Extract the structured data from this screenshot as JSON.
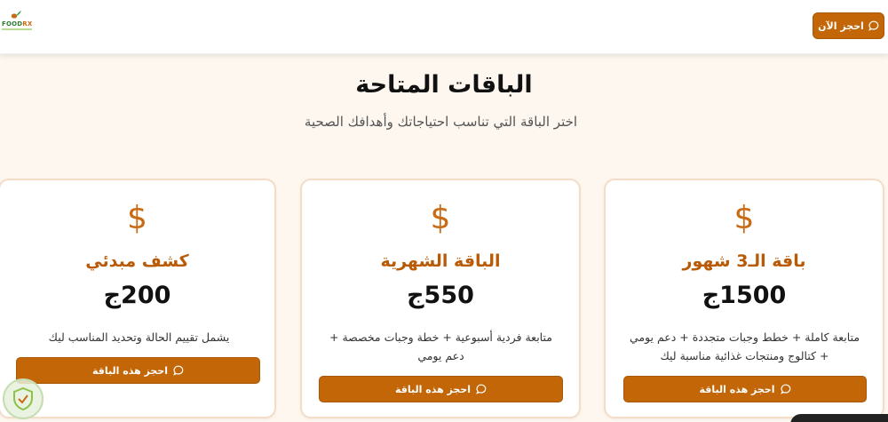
{
  "header": {
    "logo_text_food": "FOOD",
    "logo_text_rx": "RX",
    "book_now_label": "احجز الآن",
    "book_now_icon": "chat-bubble-icon"
  },
  "section": {
    "title": "الباقات المتاحة",
    "subtitle": "اختر الباقة التي تناسب احتياجاتك وأهدافك الصحية"
  },
  "plans": [
    {
      "icon": "dollar-icon",
      "name": "كشف مبدئي",
      "price": "200ج",
      "description": "يشمل تقييم الحالة وتحديد المناسب ليك",
      "button_label": "احجز هذه الباقة"
    },
    {
      "icon": "dollar-icon",
      "name": "الباقة الشهرية",
      "price": "550ج",
      "description": "متابعة فردية أسبوعية + خطة وجبات مخصصة + دعم يومي",
      "button_label": "احجز هذه الباقة"
    },
    {
      "icon": "dollar-icon",
      "name": "باقة الـ3 شهور",
      "price": "1500ج",
      "description": "متابعة كاملة + خطط وجبات متجددة + دعم يومي + كتالوج ومنتجات غذائية مناسبة ليك",
      "button_label": "احجز هذه الباقة"
    }
  ],
  "colors": {
    "accent": "#c26607",
    "plan_name": "#b85a06",
    "card_border": "#f4dcc6",
    "page_background": "#fdf7f0"
  }
}
